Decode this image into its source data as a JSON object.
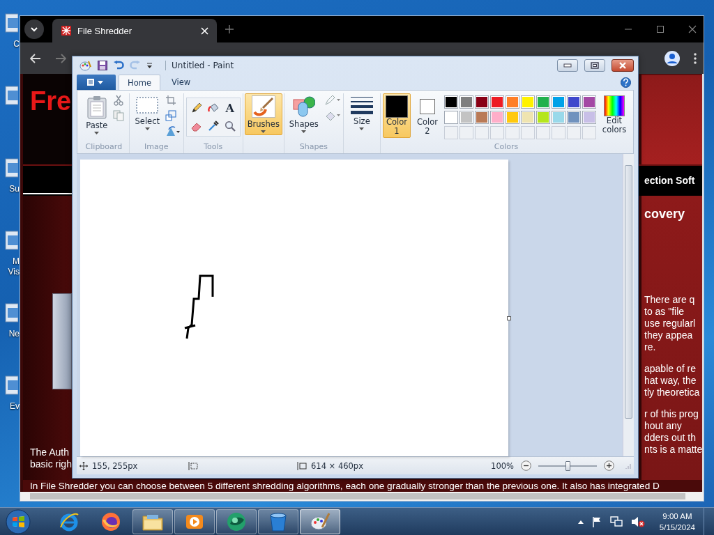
{
  "desktop_icons": [
    {
      "kind": "shortcut",
      "label": "C"
    },
    {
      "kind": "shortcut"
    },
    {
      "kind": "shortcut",
      "label": "Su"
    },
    {
      "kind": "shortcut",
      "label": "M\nVis"
    },
    {
      "kind": "shortcut",
      "label": "Ne"
    },
    {
      "kind": "shortcut",
      "label": "Ev"
    }
  ],
  "browser": {
    "tab": {
      "title": "File Shredder"
    },
    "page": {
      "header_title": "Fre",
      "nav_text": "ection Soft",
      "heading": "covery",
      "right_paragraphs": [
        [
          "There are q",
          "to as \"file",
          "use regularl",
          "they appea",
          "re."
        ],
        [
          "apable of re",
          "hat way, the",
          "tly theoretica"
        ],
        [
          "r of this prog",
          "hout any",
          "dders out th",
          "nts is a matte"
        ]
      ],
      "left_lines": [
        "The Auth",
        "basic righ"
      ],
      "bottom_line": "In File Shredder you can choose between 5 different shredding algorithms, each one gradually stronger than the previous one. It also has integrated D"
    }
  },
  "paint": {
    "title": "Untitled - Paint",
    "quick_access": [
      {
        "kind": "app",
        "disabled": false
      },
      {
        "kind": "save",
        "disabled": false
      },
      {
        "kind": "undo",
        "disabled": false
      },
      {
        "kind": "redo",
        "disabled": true
      },
      {
        "kind": "customize",
        "disabled": false
      }
    ],
    "tabs": [
      {
        "label": "Home",
        "selected": true
      },
      {
        "label": "View",
        "selected": false
      }
    ],
    "clipboard": {
      "label": "Clipboard",
      "paste": "Paste"
    },
    "image": {
      "label": "Image",
      "select": "Select"
    },
    "tools": {
      "label": "Tools",
      "items": [
        {
          "kind": "pencil",
          "selected": false
        },
        {
          "kind": "fill",
          "selected": false
        },
        {
          "kind": "text",
          "glyph": "A",
          "selected": false
        },
        {
          "kind": "eraser",
          "selected": false
        },
        {
          "kind": "picker",
          "selected": false
        },
        {
          "kind": "magnifier",
          "selected": false
        }
      ]
    },
    "brushes": {
      "label": "Brushes",
      "selected": true
    },
    "shapes": {
      "label": "Shapes",
      "button": "Shapes"
    },
    "size": {
      "label": "Size"
    },
    "colors": {
      "label": "Colors",
      "color1": {
        "label": "Color 1",
        "color": "#000000",
        "selected": true
      },
      "color2": {
        "label": "Color 2",
        "color": "#ffffff",
        "selected": false
      },
      "palette": [
        {
          "kind": "swatch",
          "color": "#000000"
        },
        {
          "kind": "swatch",
          "color": "#7f7f7f"
        },
        {
          "kind": "swatch",
          "color": "#880015"
        },
        {
          "kind": "swatch",
          "color": "#ed1c24"
        },
        {
          "kind": "swatch",
          "color": "#ff7f27"
        },
        {
          "kind": "swatch",
          "color": "#fff200"
        },
        {
          "kind": "swatch",
          "color": "#22b14c"
        },
        {
          "kind": "swatch",
          "color": "#00a2e8"
        },
        {
          "kind": "swatch",
          "color": "#3f48cc"
        },
        {
          "kind": "swatch",
          "color": "#a349a4"
        },
        {
          "kind": "swatch",
          "color": "#ffffff"
        },
        {
          "kind": "swatch",
          "color": "#c3c3c3"
        },
        {
          "kind": "swatch",
          "color": "#b97a57"
        },
        {
          "kind": "swatch",
          "color": "#ffaec9"
        },
        {
          "kind": "swatch",
          "color": "#ffc90e"
        },
        {
          "kind": "swatch",
          "color": "#efe4b0"
        },
        {
          "kind": "swatch",
          "color": "#b5e61d"
        },
        {
          "kind": "swatch",
          "color": "#99d9ea"
        },
        {
          "kind": "swatch",
          "color": "#7092be"
        },
        {
          "kind": "swatch",
          "color": "#c8bfe7"
        },
        {
          "kind": "empty"
        },
        {
          "kind": "empty"
        },
        {
          "kind": "empty"
        },
        {
          "kind": "empty"
        },
        {
          "kind": "empty"
        },
        {
          "kind": "empty"
        },
        {
          "kind": "empty"
        },
        {
          "kind": "empty"
        },
        {
          "kind": "empty"
        },
        {
          "kind": "empty"
        }
      ],
      "edit": "Edit colors"
    },
    "status": {
      "position": "155, 255px",
      "size": "614 × 460px",
      "zoom": "100%",
      "zoom_slider": {
        "level": 0.5
      }
    }
  },
  "taskbar": {
    "items": [
      {
        "kind": "ie",
        "running": false,
        "selected": false
      },
      {
        "kind": "firefox",
        "running": false,
        "selected": false
      },
      {
        "kind": "explorer",
        "running": true,
        "selected": false
      },
      {
        "kind": "media",
        "running": true,
        "selected": false
      },
      {
        "kind": "sphere",
        "running": true,
        "selected": false
      },
      {
        "kind": "bucket",
        "running": true,
        "selected": false
      },
      {
        "kind": "paint",
        "running": true,
        "selected": true
      }
    ],
    "time": "9:00 AM",
    "date": "5/15/2024"
  }
}
